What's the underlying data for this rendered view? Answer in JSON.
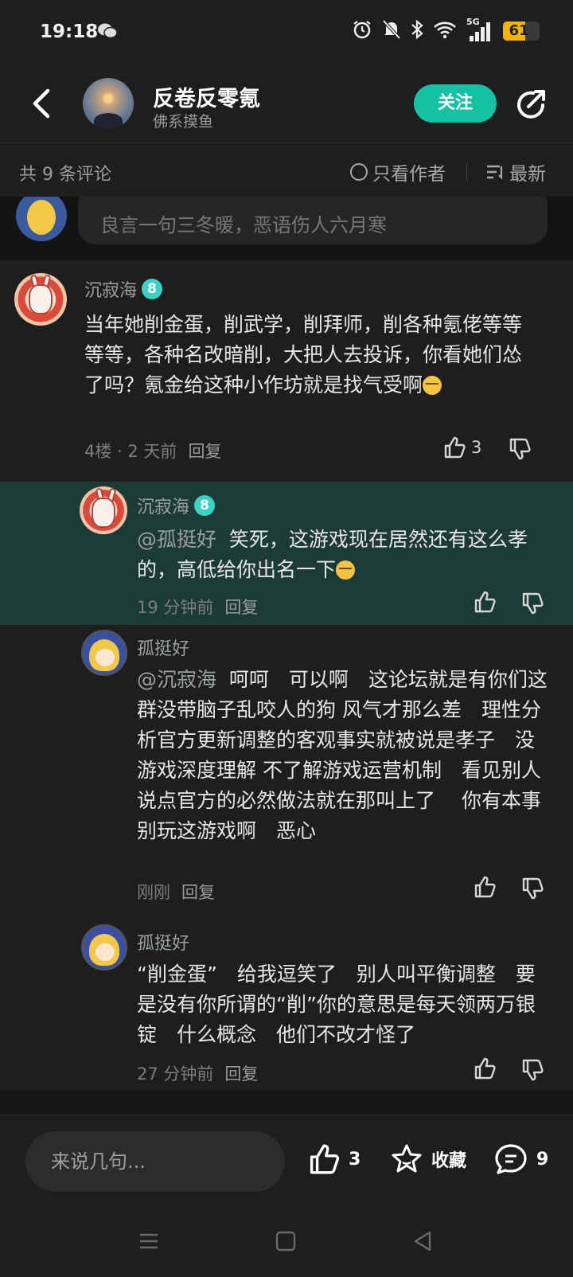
{
  "status": {
    "time": "19:18",
    "network": "5G",
    "battery": "61",
    "battery_level": 0.61
  },
  "header": {
    "title": "反卷反零氪",
    "subtitle": "佛系摸鱼",
    "follow_label": "关注"
  },
  "comment_bar": {
    "count_label": "共 9 条评论",
    "only_author_label": "只看作者",
    "sort_label": "最新"
  },
  "previous_comment": {
    "text": "良言一句三冬暖，恶语伤人六月寒"
  },
  "comment": {
    "user": "沉寂海",
    "level": "8",
    "text": "当年她削金蛋，削武学，削拜师，削各种氪佬等等等等，各种名改暗削，大把人去投诉，你看她们怂了吗？氪金给这种小作坊就是找气受啊",
    "floor": "4楼 · 2 天前",
    "reply_label": "回复",
    "likes": "3"
  },
  "replies": [
    {
      "user": "沉寂海",
      "level": "8",
      "mention": "@孤挺好",
      "text": "笑死，这游戏现在居然还有这么孝的，高低给你出名一下",
      "time": "19 分钟前",
      "reply_label": "回复"
    },
    {
      "user": "孤挺好",
      "mention": "@沉寂海",
      "text": "呵呵　可以啊　这论坛就是有你们这群没带脑子乱咬人的狗 风气才那么差　理性分析官方更新调整的客观事实就被说是孝子　没游戏深度理解 不了解游戏运营机制　看见别人说点官方的必然做法就在那叫上了　 你有本事别玩这游戏啊　恶心",
      "time": "刚刚",
      "reply_label": "回复"
    },
    {
      "user": "孤挺好",
      "text": "“削金蛋”　给我逗笑了　别人叫平衡调整　要是没有你所谓的“削”你的意思是每天领两万银锭　什么概念　他们不改才怪了",
      "time": "27 分钟前",
      "reply_label": "回复"
    }
  ],
  "bottom_bar": {
    "placeholder": "来说几句...",
    "likes": "3",
    "favorite_label": "收藏",
    "comments": "9"
  },
  "colors": {
    "accent": "#16c0a3",
    "highlight_row": "#1d3b36",
    "background": "#1e1e1e"
  }
}
